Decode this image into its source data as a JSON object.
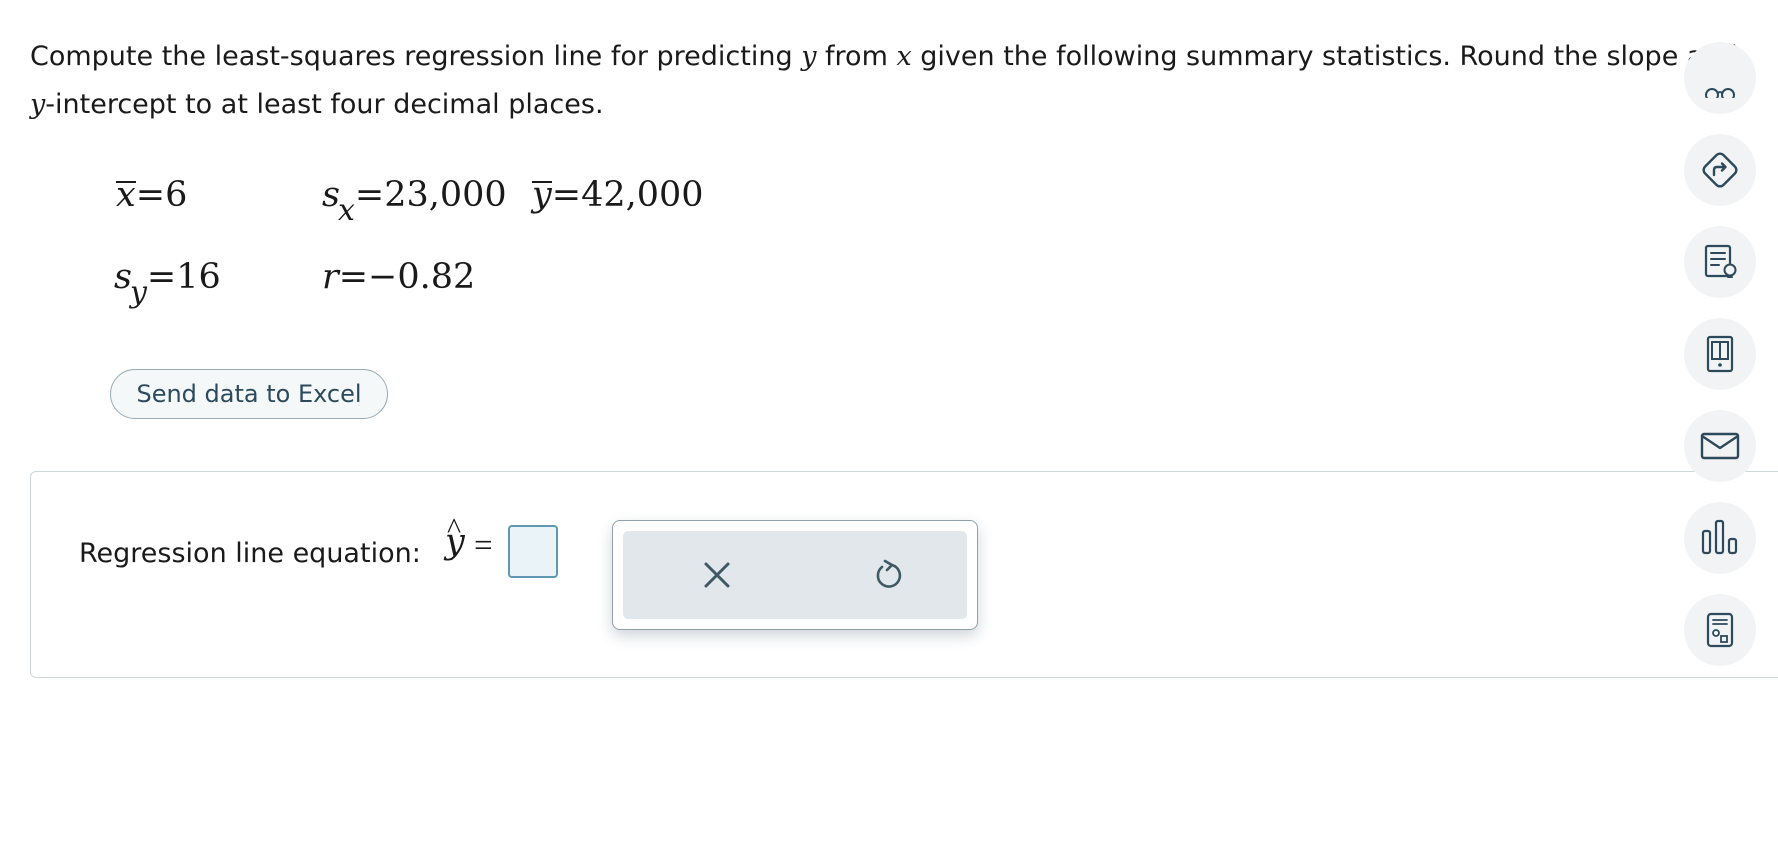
{
  "question": {
    "part1": "Compute the least-squares regression line for predicting ",
    "var_y": "y",
    "part2": " from ",
    "var_x": "x",
    "part3": " given the following summary statistics. Round the slope and ",
    "var_y2": "y",
    "part4": "-intercept to at least four decimal places."
  },
  "stats": {
    "xbar": {
      "symbol": "x",
      "value": "=6"
    },
    "sx": {
      "symbol": "s",
      "sub": "x",
      "value": "=23,000"
    },
    "ybar": {
      "symbol": "y",
      "value": "=42,000"
    },
    "sy": {
      "symbol": "s",
      "sub": "y",
      "value": "=16"
    },
    "r": {
      "symbol": "r",
      "value": "=−0.82"
    }
  },
  "excel_button": {
    "label": "Send data to Excel"
  },
  "answer": {
    "label": "Regression line equation: ",
    "yhat_symbol": "y",
    "hat": "^",
    "equals": "=",
    "input_value": ""
  },
  "colors": {
    "accent": "#2c4a5c",
    "input_border": "#5e98b3",
    "input_bg": "#eaf4f8",
    "action_bg": "#e1e7ea",
    "tool_bg": "#f1f3f4"
  },
  "sidebar_icons": [
    "glasses-icon",
    "directions-icon",
    "hint-icon",
    "ebook-icon",
    "mail-icon",
    "bar-chart-icon",
    "calculator-icon"
  ]
}
